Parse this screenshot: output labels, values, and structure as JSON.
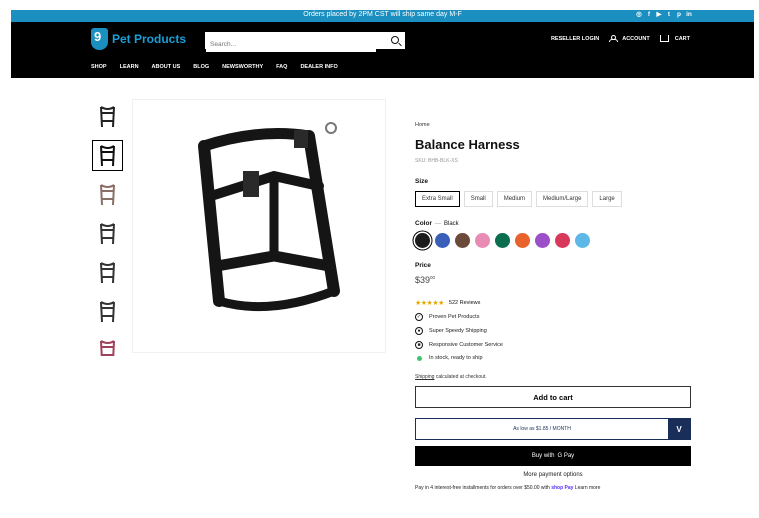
{
  "announcement": {
    "text": "Orders placed by 2PM CST will ship same day M-F",
    "social": [
      "instagram-icon",
      "facebook-icon",
      "youtube-icon",
      "twitter-icon",
      "pinterest-icon",
      "linkedin-icon"
    ]
  },
  "header": {
    "logo_text": "Pet Products",
    "search_placeholder": "Search...",
    "links": {
      "reseller": "RESELLER LOGIN",
      "account": "ACCOUNT",
      "cart": "CART"
    }
  },
  "nav": [
    "SHOP",
    "LEARN",
    "ABOUT US",
    "BLOG",
    "NEWSWORTHY",
    "FAQ",
    "DEALER INFO"
  ],
  "product": {
    "breadcrumb": "Home",
    "title": "Balance Harness",
    "sku": "SKU: BHB-BLK-XS",
    "size_label": "Size",
    "sizes": [
      "Extra Small",
      "Small",
      "Medium",
      "Medium/Large",
      "Large"
    ],
    "selected_size": "Extra Small",
    "color_label": "Color",
    "color_value": "Black",
    "colors": [
      "#1c1c1c",
      "#3a5fb8",
      "#6b4a3a",
      "#e88bb5",
      "#0b6e4f",
      "#e8622b",
      "#9b4fc9",
      "#d8395b",
      "#5db8e8"
    ],
    "price_label": "Price",
    "price_main": "$39",
    "price_cents": "00",
    "reviews": "522 Reviews",
    "features": [
      "Proven Pet Products",
      "Super Speedy Shipping",
      "Responsive Customer Service"
    ],
    "stock": "In stock, ready to ship",
    "shipping_link": "Shipping",
    "shipping_text": " calculated at checkout.",
    "add_to_cart": "Add to cart",
    "finance_text": "As low as $1.85 / MONTH",
    "gpay_prefix": "Buy with",
    "gpay_brand": "G Pay",
    "more_options": "More payment options",
    "shoppay_text": "Pay in 4 interest-free installments for orders over $50.00 with",
    "shoppay_brand": "shop Pay",
    "shoppay_learn": " Learn more"
  },
  "colors": {
    "announce_bg": "#1a8fc0",
    "header_bg": "#000000",
    "logo": "#1a9fd8",
    "star": "#e5a800",
    "in_stock": "#3ec46d"
  }
}
